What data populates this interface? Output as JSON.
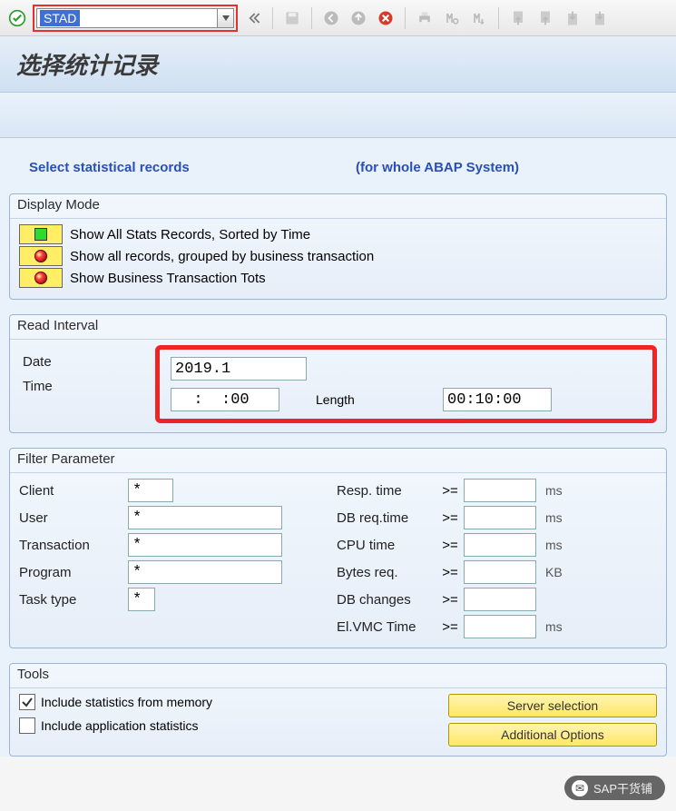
{
  "toolbar": {
    "tcode": "STAD"
  },
  "page_title": "选择统计记录",
  "headings": {
    "left": "Select statistical records",
    "right": "(for whole ABAP System)"
  },
  "display_mode": {
    "title": "Display Mode",
    "opt1": "Show All Stats Records, Sorted by Time",
    "opt2": "Show all records, grouped by business transaction",
    "opt3": "Show Business Transaction Tots"
  },
  "read_interval": {
    "title": "Read Interval",
    "date_label": "Date",
    "date_value": "2019.1",
    "time_label": "Time",
    "time_value": "  :  :00",
    "length_label": "Length",
    "length_value": "00:10:00"
  },
  "filter": {
    "title": "Filter Parameter",
    "left": [
      {
        "label": "Client",
        "value": "*"
      },
      {
        "label": "User",
        "value": "*"
      },
      {
        "label": "Transaction",
        "value": "*"
      },
      {
        "label": "Program",
        "value": "*"
      },
      {
        "label": "Task type",
        "value": "*"
      }
    ],
    "right": [
      {
        "label": "Resp. time",
        "op": ">=",
        "value": "",
        "unit": "ms"
      },
      {
        "label": "DB req.time",
        "op": ">=",
        "value": "",
        "unit": "ms"
      },
      {
        "label": "CPU time",
        "op": ">=",
        "value": "",
        "unit": "ms"
      },
      {
        "label": "Bytes req.",
        "op": ">=",
        "value": "",
        "unit": "KB"
      },
      {
        "label": "DB changes",
        "op": ">=",
        "value": "",
        "unit": ""
      },
      {
        "label": "El.VMC Time",
        "op": ">=",
        "value": "",
        "unit": "ms"
      }
    ]
  },
  "tools": {
    "title": "Tools",
    "chk1": "Include statistics from memory",
    "chk2": "Include application statistics",
    "btn1": "Server selection",
    "btn2": "Additional Options"
  },
  "watermark": "SAP干货铺"
}
